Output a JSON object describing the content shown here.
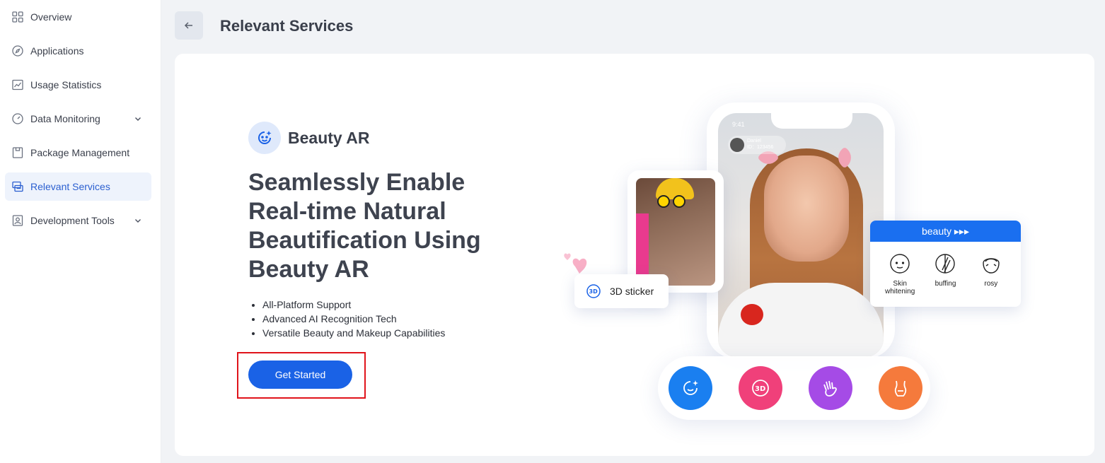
{
  "sidebar": {
    "items": [
      {
        "label": "Overview",
        "icon": "grid-icon"
      },
      {
        "label": "Applications",
        "icon": "compass-icon"
      },
      {
        "label": "Usage Statistics",
        "icon": "chart-icon"
      },
      {
        "label": "Data Monitoring",
        "icon": "gauge-icon",
        "expandable": true
      },
      {
        "label": "Package Management",
        "icon": "package-icon"
      },
      {
        "label": "Relevant Services",
        "icon": "services-icon",
        "active": true
      },
      {
        "label": "Development Tools",
        "icon": "dev-tools-icon",
        "expandable": true
      }
    ]
  },
  "header": {
    "title": "Relevant Services",
    "back_icon": "arrow-left-icon"
  },
  "product": {
    "name": "Beauty AR",
    "headline": "Seamlessly Enable Real-time Natural Beautification Using Beauty AR",
    "features": [
      "All-Platform Support",
      "Advanced AI Recognition Tech",
      "Versatile Beauty and Makeup Capabilities"
    ],
    "cta_label": "Get Started"
  },
  "illustration": {
    "status_time": "9:41",
    "user_name": "Daniel",
    "user_id": "ID：123456",
    "sticker_label": "3D sticker",
    "beauty_panel": {
      "title": "beauty ▸▸▸",
      "items": [
        {
          "label": "Skin whitening"
        },
        {
          "label": "buffing"
        },
        {
          "label": "rosy"
        }
      ]
    },
    "dock_buttons": [
      {
        "name": "beauty-face-icon",
        "color": "#1a7ff0"
      },
      {
        "name": "3d-sticker-icon",
        "color": "#f0407a"
      },
      {
        "name": "gesture-icon",
        "color": "#a54be6"
      },
      {
        "name": "body-shape-icon",
        "color": "#f57a3c"
      }
    ]
  },
  "colors": {
    "accent": "#1a62e6",
    "active_bg": "#eef3fc",
    "highlight_outline": "#e0141b"
  }
}
